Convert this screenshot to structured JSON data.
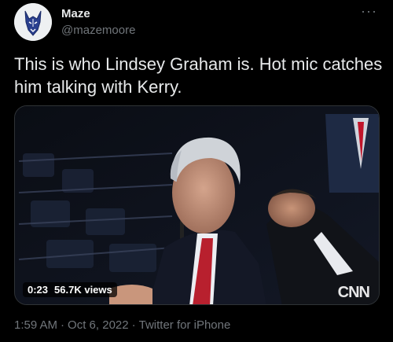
{
  "user": {
    "name": "Maze",
    "handle": "@mazemoore"
  },
  "more_label": "···",
  "tweet": {
    "text": "This is who Lindsey Graham is. Hot mic catches him talking with Kerry."
  },
  "video": {
    "duration": "0:23",
    "views": "56.7K views",
    "watermark": "CNN"
  },
  "meta": {
    "time": "1:59 AM",
    "sep1": "·",
    "date": "Oct 6, 2022",
    "sep2": "·",
    "source": "Twitter for iPhone"
  },
  "icons": {
    "avatar": "dog-avatar-icon",
    "more": "more-options-icon"
  }
}
